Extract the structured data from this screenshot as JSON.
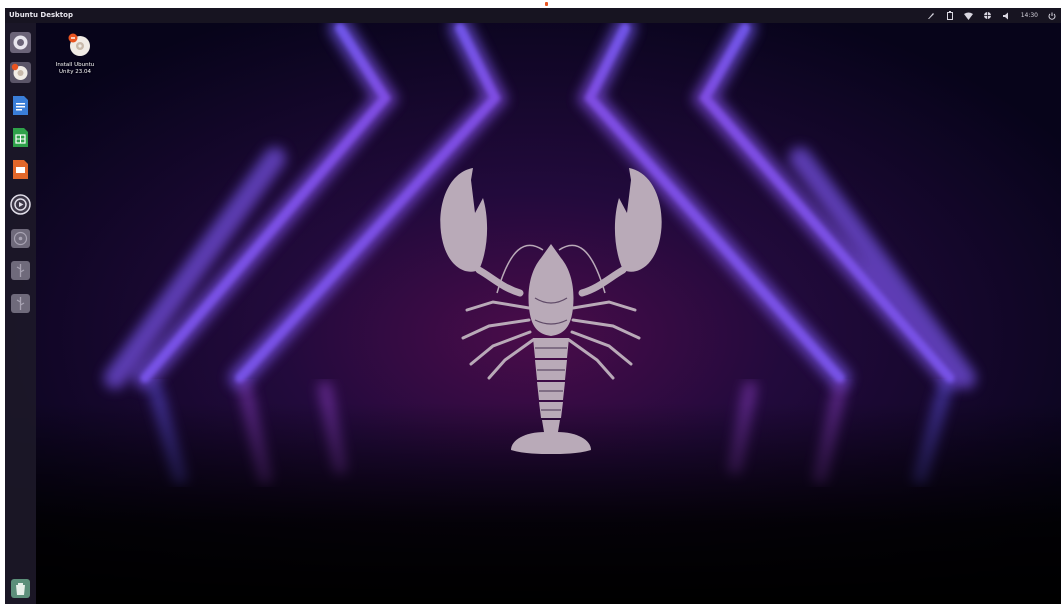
{
  "panel": {
    "title": "Ubuntu Desktop",
    "clock": "14:30",
    "indicators": [
      "pen-icon",
      "battery-icon",
      "wifi-icon",
      "network-icon",
      "volume-icon"
    ]
  },
  "launcher": {
    "items": [
      {
        "name": "dash-home",
        "icon": "ubuntu-dash-icon"
      },
      {
        "name": "install-ubuntu",
        "icon": "installer-icon"
      },
      {
        "name": "libreoffice-writer",
        "icon": "writer-icon"
      },
      {
        "name": "libreoffice-calc",
        "icon": "calc-icon"
      },
      {
        "name": "libreoffice-impress",
        "icon": "impress-icon"
      },
      {
        "name": "rhythmbox",
        "icon": "music-player-icon"
      },
      {
        "name": "optical-drive",
        "icon": "disc-icon"
      },
      {
        "name": "usb-drive-1",
        "icon": "usb-drive-icon"
      },
      {
        "name": "usb-drive-2",
        "icon": "usb-drive-icon"
      },
      {
        "name": "trash",
        "icon": "trash-icon"
      }
    ]
  },
  "desktop": {
    "icons": [
      {
        "label_line1": "Install Ubuntu",
        "label_line2": "Unity 23.04",
        "icon": "installer-icon"
      }
    ]
  },
  "colors": {
    "panel": "#171421",
    "launcher": "#1c1828",
    "accent": "#e95420",
    "mascot": "#b9aab8",
    "neon_blue": "#4f6dff",
    "neon_purple": "#a43bd8"
  }
}
